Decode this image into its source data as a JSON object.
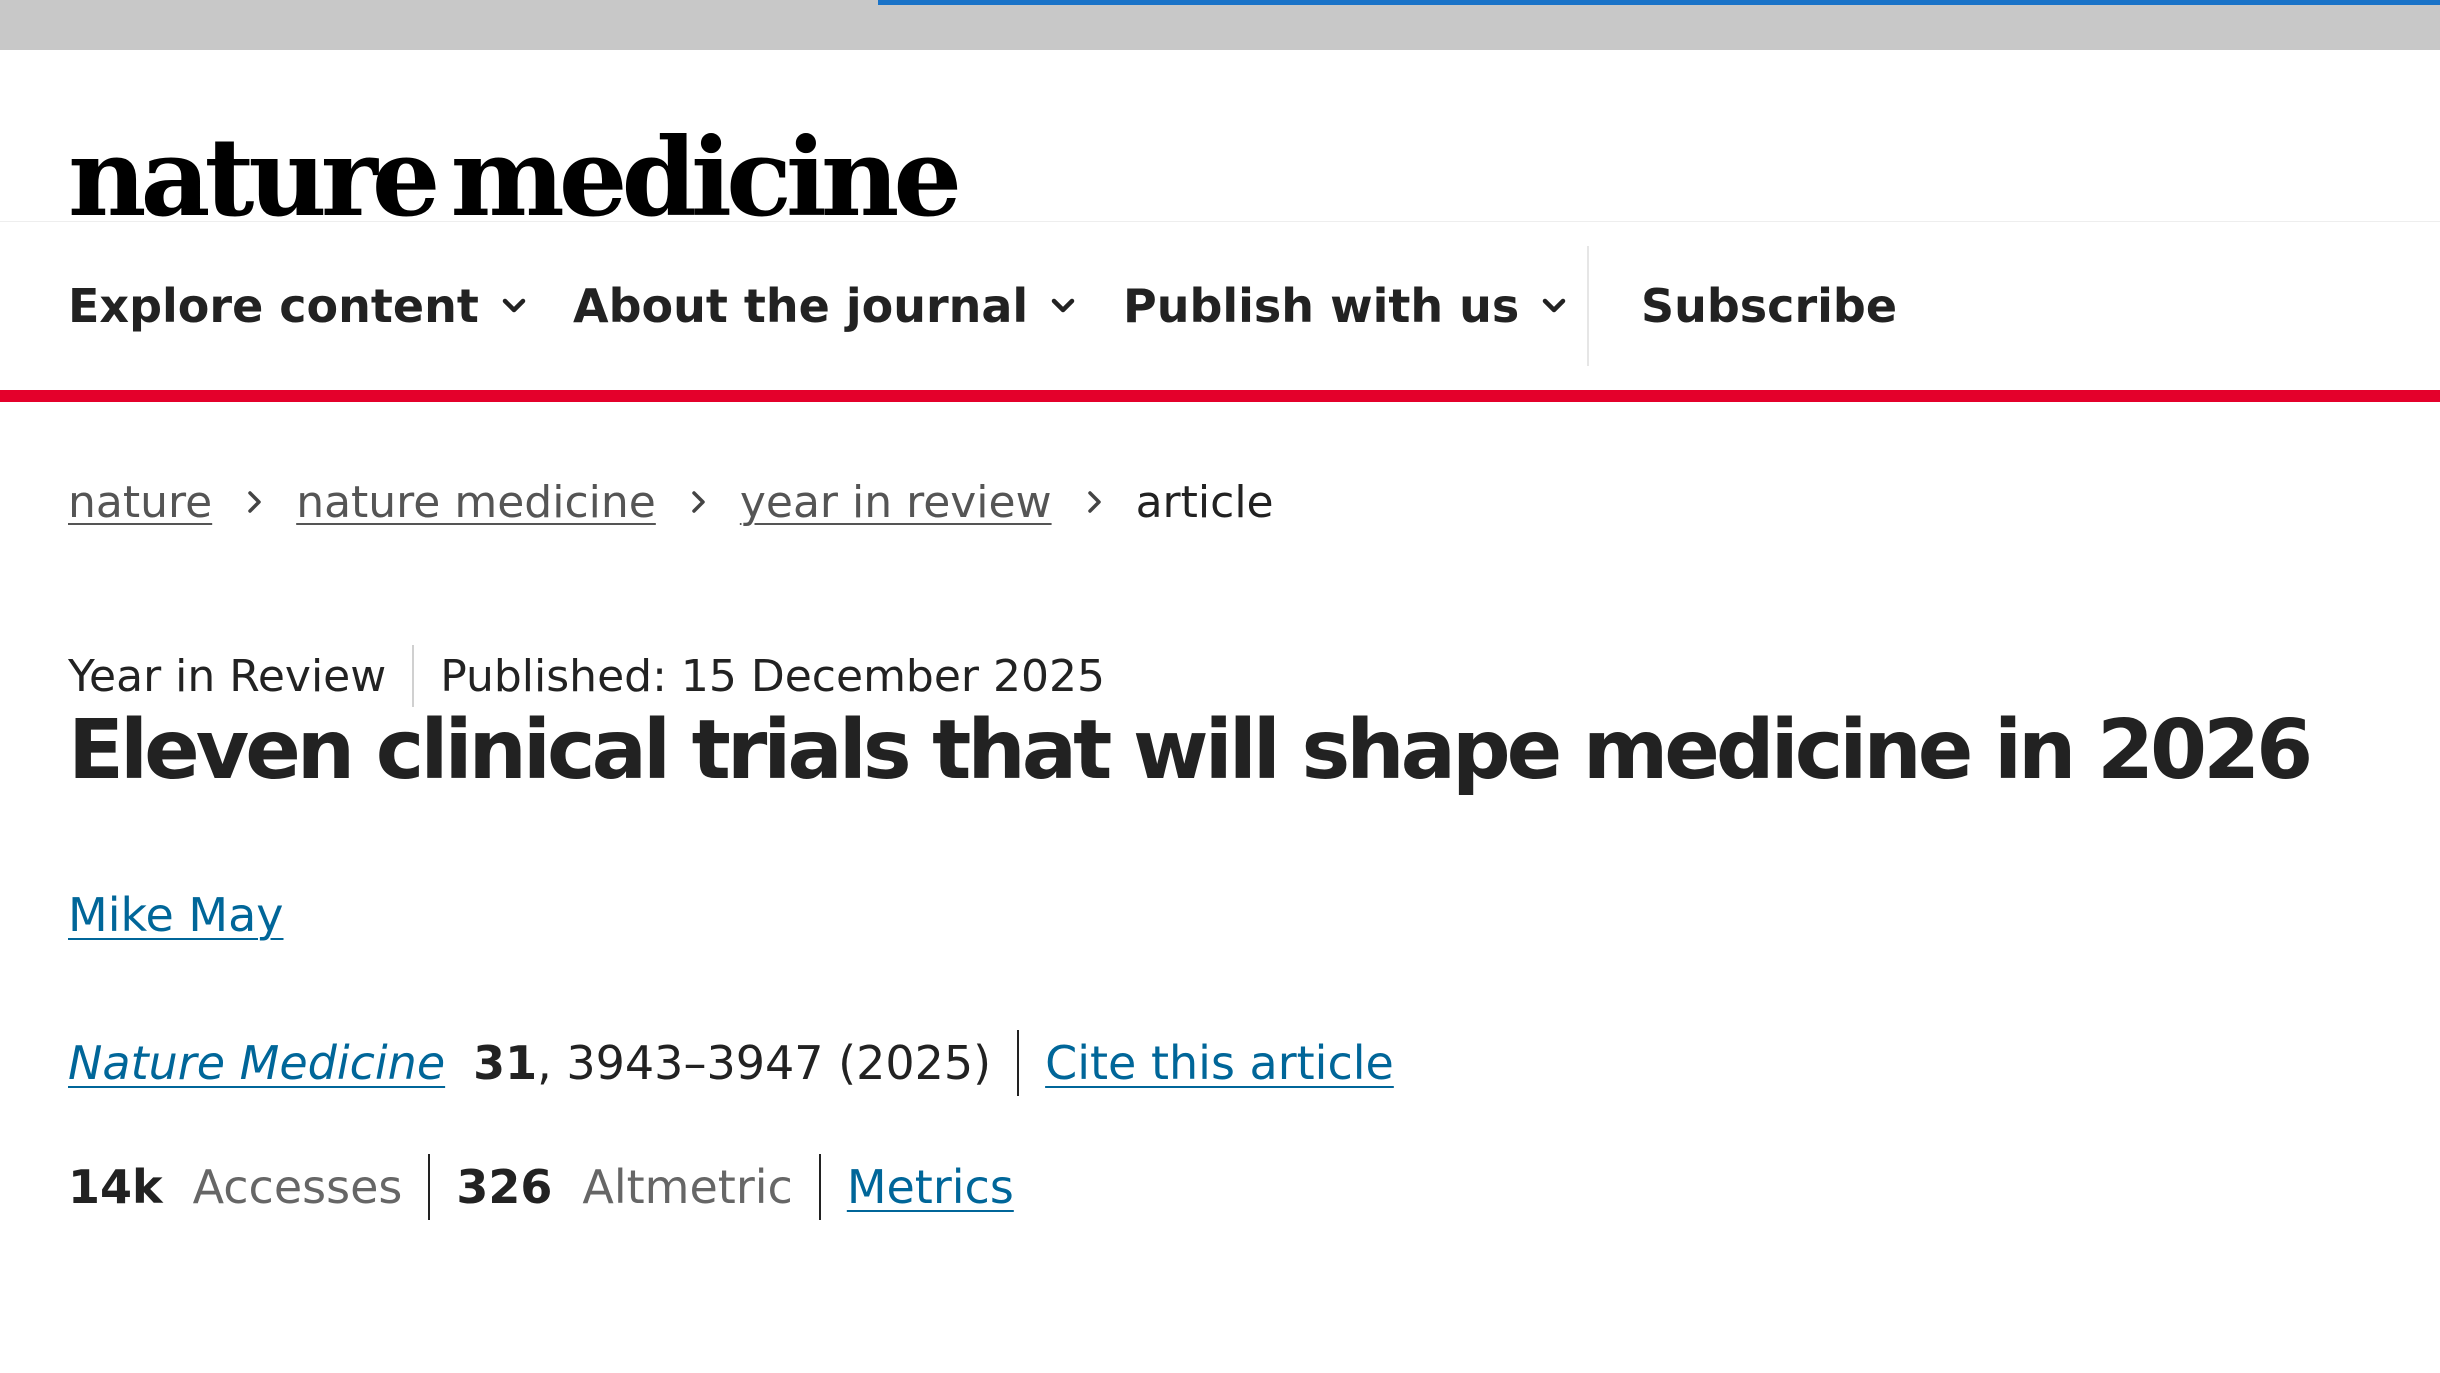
{
  "logo": {
    "word1": "nature",
    "word2": "medicine"
  },
  "nav": {
    "explore_label": "Explore content",
    "about_label": "About the journal",
    "publish_label": "Publish with us",
    "subscribe_label": "Subscribe"
  },
  "breadcrumb": {
    "items": [
      "nature",
      "nature medicine",
      "year in review"
    ],
    "current": "article"
  },
  "article": {
    "type": "Year in Review",
    "published": "Published: 15 December 2025",
    "title": "Eleven clinical trials that will shape medicine in 2026",
    "author": "Mike May",
    "journal": "Nature Medicine",
    "volume": "31",
    "pages": ", 3943–3947 (2025)",
    "cite_label": "Cite this article"
  },
  "metrics": {
    "accesses_value": "14k",
    "accesses_label": "Accesses",
    "altmetric_value": "326",
    "altmetric_label": "Altmetric",
    "link_label": "Metrics"
  },
  "colors": {
    "accent_red": "#e4002b",
    "link_blue": "#006699",
    "loading_bar": "#1a73c8"
  },
  "icons": {
    "nav_dropdown": "chevron-down-icon",
    "breadcrumb_separator": "chevron-right-icon"
  }
}
